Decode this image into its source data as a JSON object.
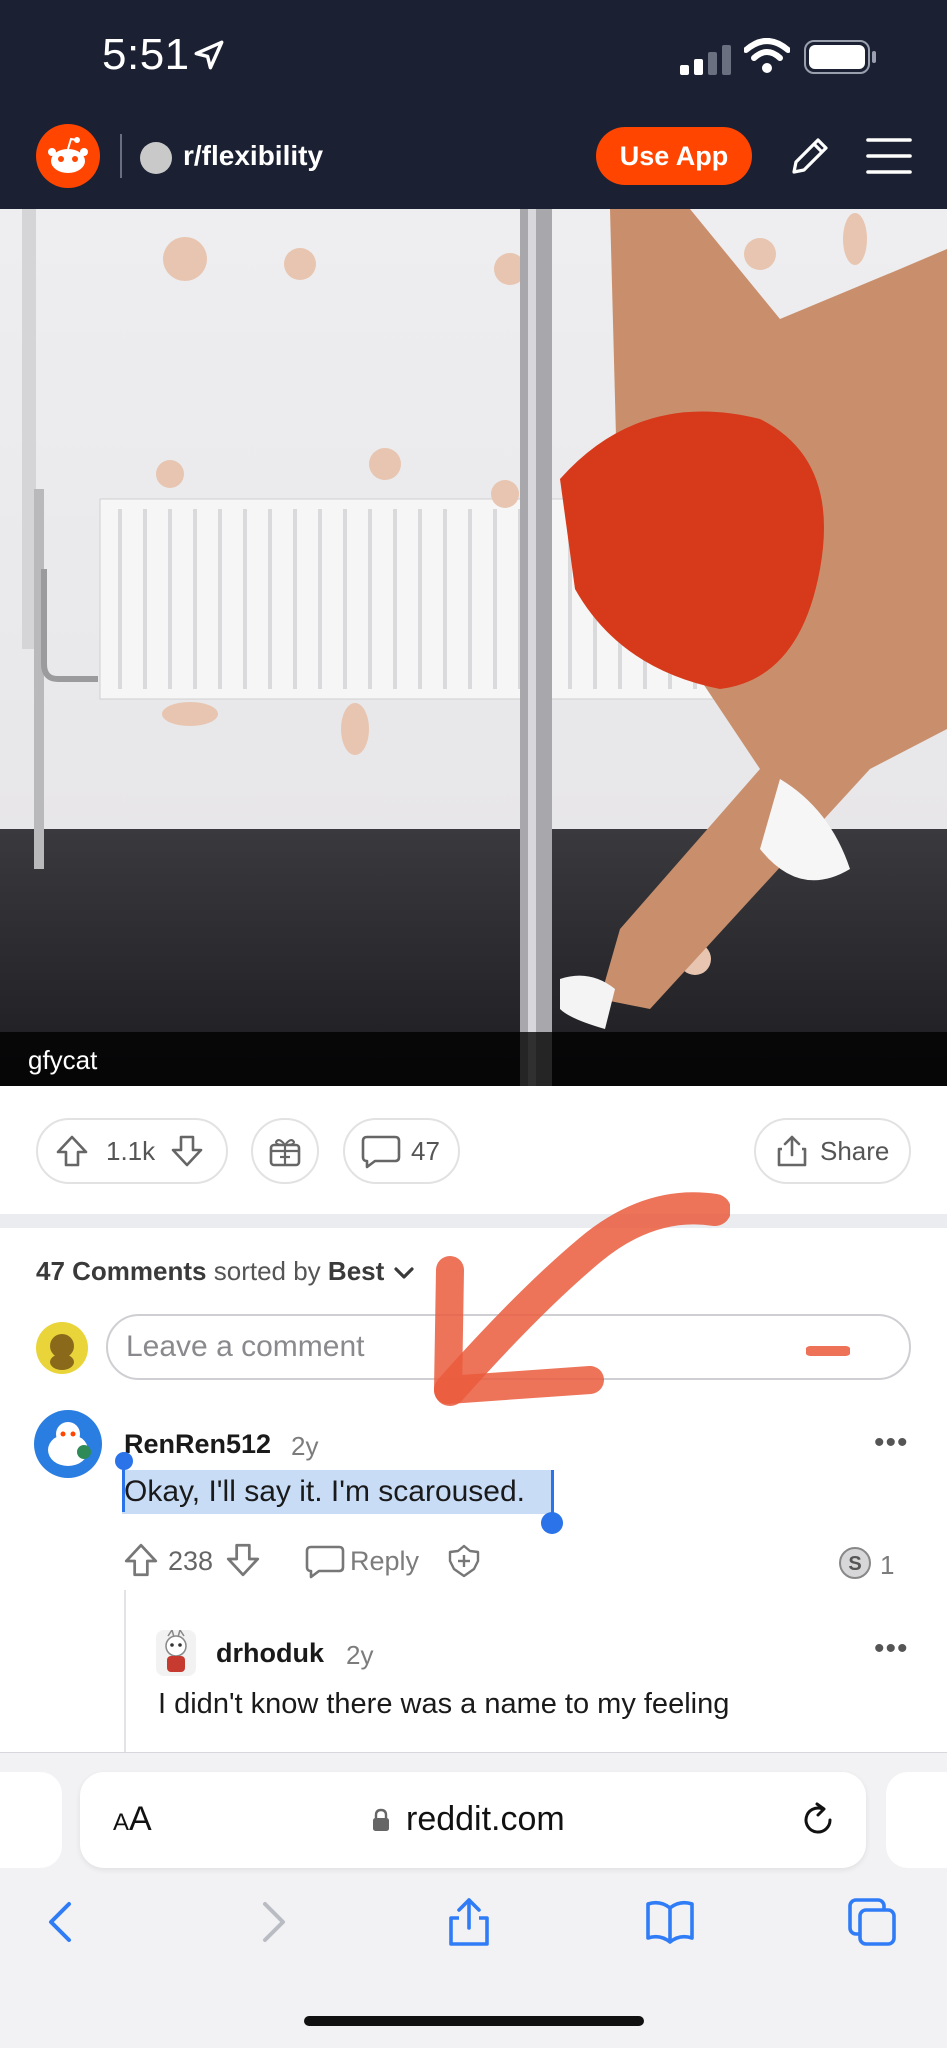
{
  "status_bar": {
    "time": "5:51"
  },
  "header": {
    "subreddit": "r/flexibility",
    "use_app_label": "Use App"
  },
  "post": {
    "video_source": "gfycat",
    "score": "1.1k",
    "comment_count": "47",
    "share_label": "Share"
  },
  "comments_section": {
    "count_label": "47 Comments",
    "sorted_by_label": "sorted by",
    "sort_value": "Best",
    "input_placeholder": "Leave a comment"
  },
  "comments": [
    {
      "user": "RenRen512",
      "age": "2y",
      "body": "Okay, I'll say it. I'm scaroused.",
      "score": "238",
      "reply_label": "Reply",
      "award_count": "1",
      "more": "•••"
    }
  ],
  "replies": [
    {
      "user": "drhoduk",
      "age": "2y",
      "body": "I didn't know there was a name to my feeling",
      "more": "•••"
    }
  ],
  "browser": {
    "aa_label_small": "A",
    "aa_label_big": "A",
    "url": "reddit.com"
  },
  "colors": {
    "reddit_orange": "#ff4500",
    "header_bg": "#1b2133",
    "selection_blue": "#2a73e8",
    "annotation_orange": "#ea5a3c"
  }
}
